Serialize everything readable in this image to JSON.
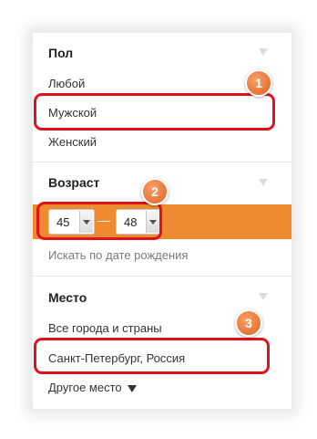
{
  "gender": {
    "title": "Пол",
    "options": [
      "Любой",
      "Мужской",
      "Женский"
    ]
  },
  "age": {
    "title": "Возраст",
    "from": "45",
    "to": "48",
    "separator": "—",
    "birthdate_link": "Искать по дате рождения"
  },
  "place": {
    "title": "Место",
    "options": [
      "Все города и страны",
      "Санкт-Петербург, Россия"
    ],
    "other": "Другое место"
  },
  "badges": [
    "1",
    "2",
    "3"
  ],
  "colors": {
    "accent": "#ee8a2f",
    "highlight": "#e0121a"
  }
}
